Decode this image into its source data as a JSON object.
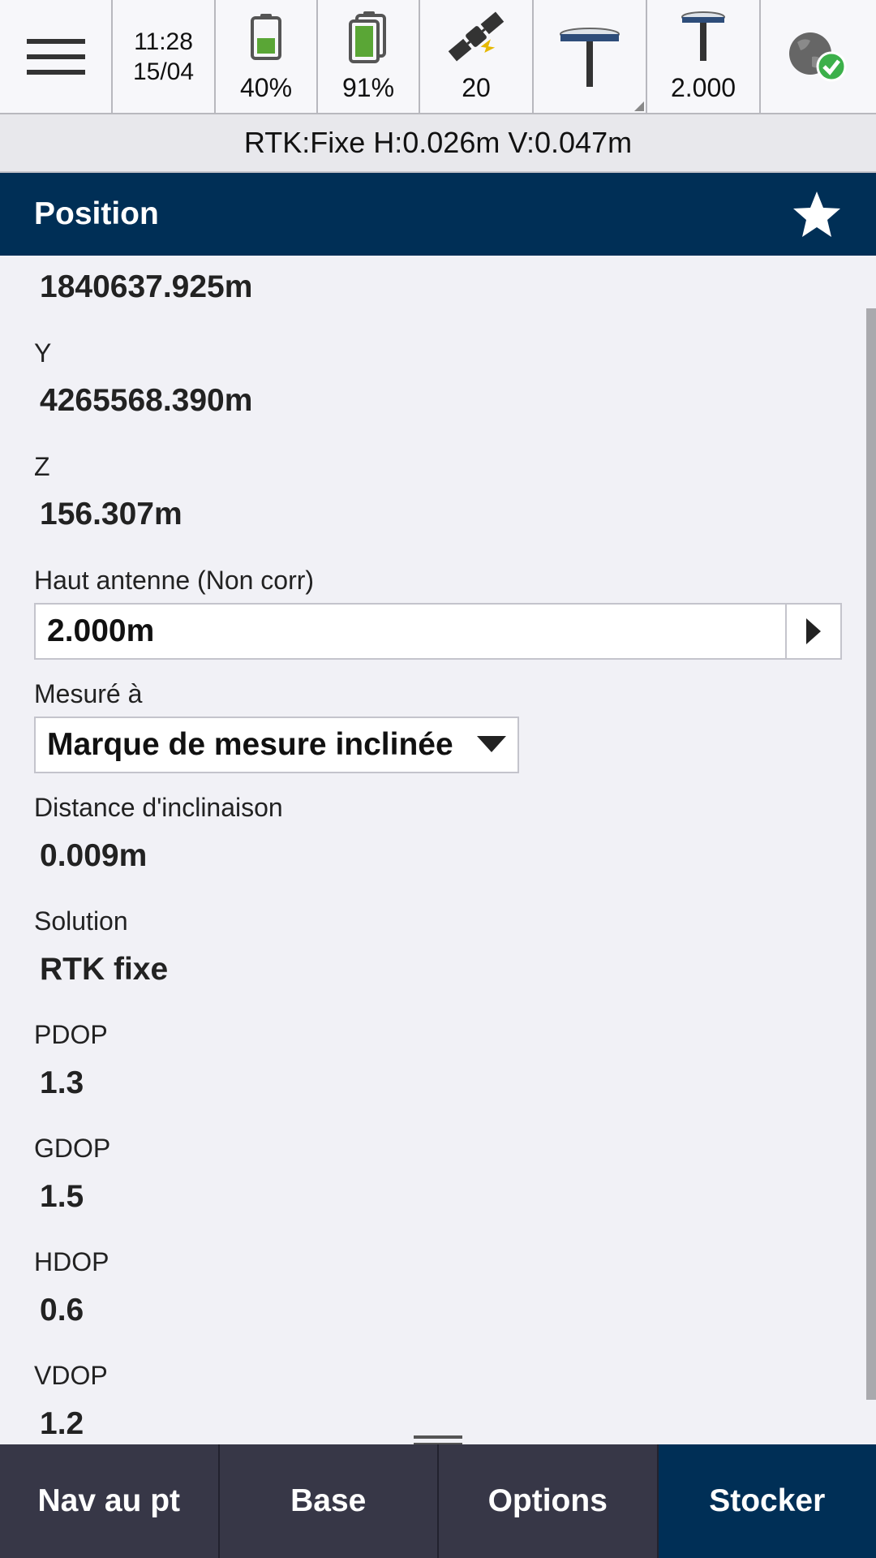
{
  "status": {
    "time": "11:28",
    "date": "15/04",
    "controller_battery": "40%",
    "receiver_battery": "91%",
    "satellites": "20",
    "antenna_height": "2.000"
  },
  "rtk_status": "RTK:Fixe H:0.026m V:0.047m",
  "header": {
    "title": "Position"
  },
  "fields": {
    "x_value": "1840637.925m",
    "y_label": "Y",
    "y_value": "4265568.390m",
    "z_label": "Z",
    "z_value": "156.307m",
    "antenna_label": "Haut antenne (Non corr)",
    "antenna_value": "2.000m",
    "measured_label": "Mesuré à",
    "measured_value": "Marque de mesure inclinée",
    "tilt_label": "Distance d'inclinaison",
    "tilt_value": "0.009m",
    "solution_label": "Solution",
    "solution_value": "RTK fixe",
    "pdop_label": "PDOP",
    "pdop_value": "1.3",
    "gdop_label": "GDOP",
    "gdop_value": "1.5",
    "hdop_label": "HDOP",
    "hdop_value": "0.6",
    "vdop_label": "VDOP",
    "vdop_value": "1.2"
  },
  "bottom": {
    "nav": "Nav au pt",
    "base": "Base",
    "options": "Options",
    "store": "Stocker"
  },
  "colors": {
    "header_bg": "#002f56",
    "bottom_bg": "#373747",
    "battery_green": "#5aa636",
    "check_green": "#3cb04a"
  },
  "icons": [
    "hamburger-menu-icon",
    "battery-icon",
    "double-battery-icon",
    "satellite-icon",
    "receiver-pole-icon",
    "antenna-pole-icon",
    "globe-check-icon",
    "star-icon",
    "caret-right-icon",
    "dropdown-triangle-icon",
    "drag-handle-icon"
  ]
}
